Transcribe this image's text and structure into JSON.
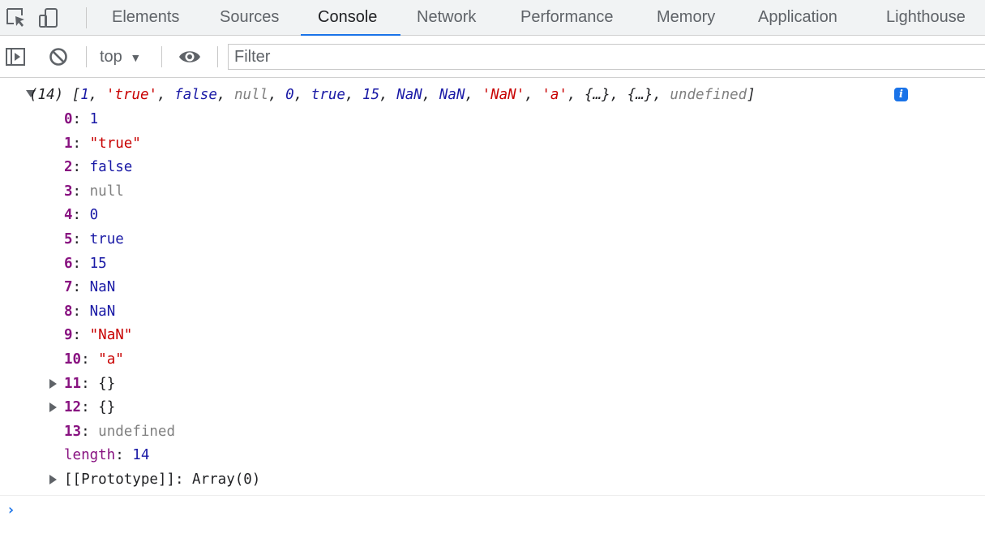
{
  "tabs": [
    "Elements",
    "Sources",
    "Console",
    "Network",
    "Performance",
    "Memory",
    "Application",
    "Lighthouse"
  ],
  "active_tab": "Console",
  "toolbar": {
    "context_label": "top",
    "context_caret": "▼",
    "filter_placeholder": "Filter",
    "filter_value": ""
  },
  "log": {
    "summary": {
      "count": "(14)",
      "open_bracket": "[",
      "items": [
        {
          "text": "1",
          "kind": "num"
        },
        {
          "text": "'true'",
          "kind": "str"
        },
        {
          "text": "false",
          "kind": "num"
        },
        {
          "text": "null",
          "kind": "null"
        },
        {
          "text": "0",
          "kind": "num"
        },
        {
          "text": "true",
          "kind": "num"
        },
        {
          "text": "15",
          "kind": "num"
        },
        {
          "text": "NaN",
          "kind": "num"
        },
        {
          "text": "NaN",
          "kind": "num"
        },
        {
          "text": "'NaN'",
          "kind": "str"
        },
        {
          "text": "'a'",
          "kind": "str"
        },
        {
          "text": "{…}",
          "kind": "plain"
        },
        {
          "text": "{…}",
          "kind": "plain"
        },
        {
          "text": "undefined",
          "kind": "null"
        }
      ],
      "close_bracket": "]",
      "info_icon": "i"
    },
    "entries": [
      {
        "key": "0",
        "value": "1",
        "kind": "num",
        "expandable": false
      },
      {
        "key": "1",
        "value": "\"true\"",
        "kind": "str",
        "expandable": false
      },
      {
        "key": "2",
        "value": "false",
        "kind": "num",
        "expandable": false
      },
      {
        "key": "3",
        "value": "null",
        "kind": "null",
        "expandable": false
      },
      {
        "key": "4",
        "value": "0",
        "kind": "num",
        "expandable": false
      },
      {
        "key": "5",
        "value": "true",
        "kind": "num",
        "expandable": false
      },
      {
        "key": "6",
        "value": "15",
        "kind": "num",
        "expandable": false
      },
      {
        "key": "7",
        "value": "NaN",
        "kind": "num",
        "expandable": false
      },
      {
        "key": "8",
        "value": "NaN",
        "kind": "num",
        "expandable": false
      },
      {
        "key": "9",
        "value": "\"NaN\"",
        "kind": "str",
        "expandable": false
      },
      {
        "key": "10",
        "value": "\"a\"",
        "kind": "str",
        "expandable": false
      },
      {
        "key": "11",
        "value": "{}",
        "kind": "plain",
        "expandable": true
      },
      {
        "key": "12",
        "value": "{}",
        "kind": "plain",
        "expandable": true
      },
      {
        "key": "13",
        "value": "undefined",
        "kind": "null",
        "expandable": false
      },
      {
        "key": "length",
        "value": "14",
        "kind": "num",
        "expandable": false,
        "nonbold": true
      },
      {
        "key": "[[Prototype]]",
        "value": "Array(0)",
        "kind": "plain",
        "expandable": true,
        "plainkey": true
      }
    ],
    "prompt": "›"
  },
  "colors": {
    "number": "#1a1aa6",
    "string": "#c80000",
    "null": "#808080",
    "key": "#881280",
    "accent": "#1a73e8"
  },
  "icons": {
    "inspect": "inspect-element-icon",
    "device": "device-toolbar-icon",
    "sidebar": "show-sidebar-icon",
    "clear": "clear-console-icon",
    "eye": "live-expression-icon"
  }
}
